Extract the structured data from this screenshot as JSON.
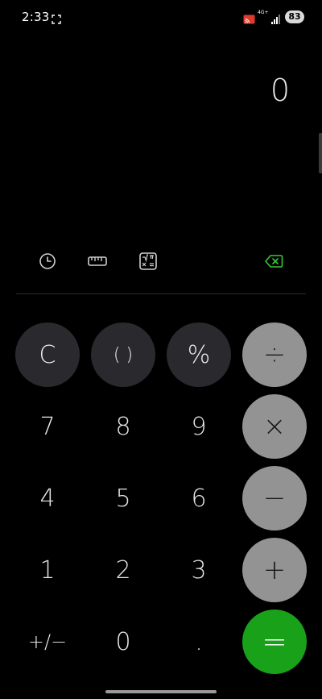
{
  "status_bar": {
    "time": "2:33",
    "network": "4G+",
    "battery": "83"
  },
  "display": {
    "value": "0"
  },
  "toolbar": {
    "icons": [
      "history-icon",
      "ruler-icon",
      "scientific-icon",
      "backspace-icon"
    ]
  },
  "keypad": {
    "row1": [
      "C",
      "( )",
      "%",
      "÷"
    ],
    "row2": [
      "7",
      "8",
      "9",
      "×"
    ],
    "row3": [
      "4",
      "5",
      "6",
      "−"
    ],
    "row4": [
      "1",
      "2",
      "3",
      "+"
    ],
    "row5": [
      "+/−",
      "0",
      ".",
      "="
    ]
  },
  "colors": {
    "background": "#000000",
    "function_key": "#2a2a2e",
    "operator_key": "#939393",
    "equals_key": "#1aa11a",
    "backspace_accent": "#37c837"
  }
}
